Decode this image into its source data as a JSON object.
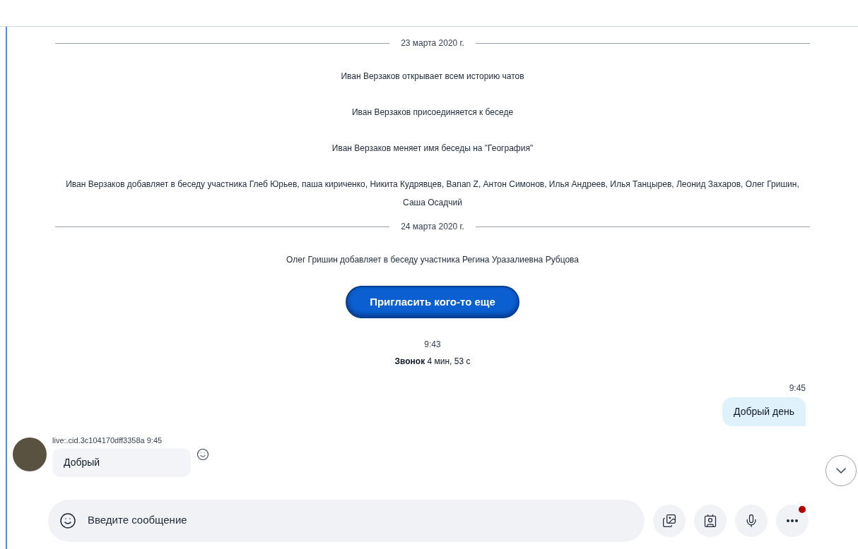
{
  "feed": [
    {
      "kind": "date",
      "text": "23 марта 2020 г."
    },
    {
      "kind": "system",
      "text": "Иван Верзаков открывает всем историю чатов"
    },
    {
      "kind": "system",
      "text": "Иван Верзаков присоединяется к беседе"
    },
    {
      "kind": "system",
      "text": "Иван Верзаков меняет имя беседы на \"География\""
    },
    {
      "kind": "system",
      "text": "Иван Верзаков добавляет в беседу участника Глеб Юрьев, паша кириченко, Никита Кудрявцев, Banan Z, Антон Симонов, Илья Андреев, Илья Танцырев, Леонид Захаров, Олег Гришин, Саша Осадчий"
    },
    {
      "kind": "date",
      "text": "24 марта 2020 г."
    },
    {
      "kind": "system",
      "text": "Олег Гришин добавляет в беседу участника Регина Уразалиевна Рубцова"
    },
    {
      "kind": "invite",
      "text": "Пригласить кого-то еще"
    },
    {
      "kind": "call",
      "time": "9:43",
      "text": "**Звонок** 4 мин, 53 с"
    },
    {
      "kind": "outgoing",
      "time": "9:45",
      "text": "Добрый день"
    },
    {
      "kind": "incoming",
      "sender": "live:.cid.3c104170dff3358a 9:45",
      "text": "Добрый"
    }
  ],
  "composer": {
    "placeholder": "Введите сообщение",
    "more_badge": true
  }
}
